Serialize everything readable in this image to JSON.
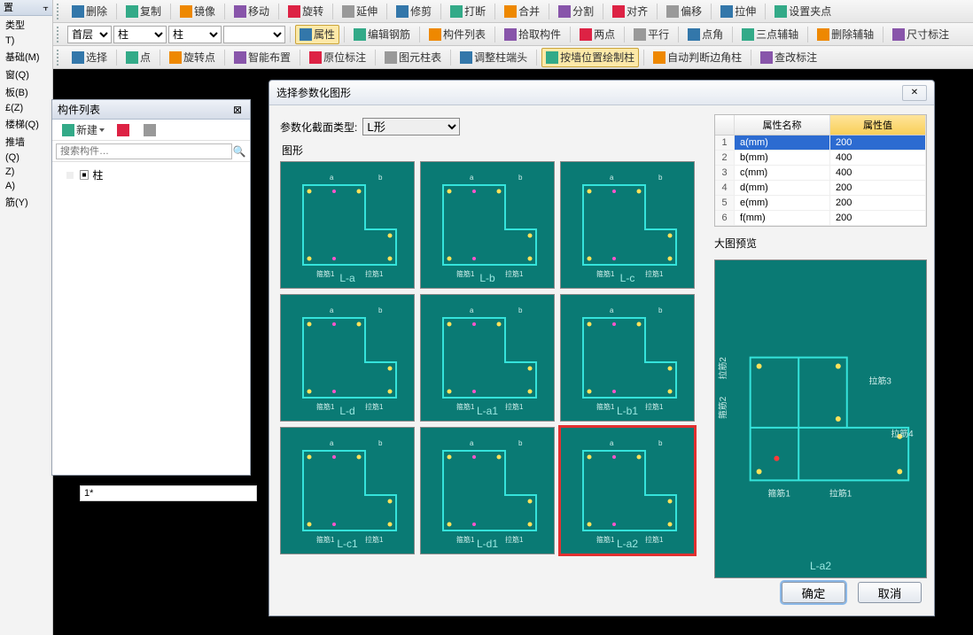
{
  "toolbars": {
    "row1": [
      "删除",
      "复制",
      "镜像",
      "移动",
      "旋转",
      "延伸",
      "修剪",
      "打断",
      "合并",
      "分割",
      "对齐",
      "偏移",
      "拉伸",
      "设置夹点"
    ],
    "row2_floor": "首层",
    "row2_cat1": "柱",
    "row2_cat2": "柱",
    "row2_btns": [
      "属性",
      "编辑钢筋",
      "构件列表",
      "拾取构件",
      "两点",
      "平行",
      "点角",
      "三点辅轴",
      "删除辅轴",
      "尺寸标注"
    ],
    "row3_btns": [
      "选择",
      "点",
      "旋转点",
      "智能布置",
      "原位标注",
      "图元柱表",
      "调整柱端头",
      "按墙位置绘制柱",
      "自动判断边角柱",
      "查改标注"
    ]
  },
  "left_dock": {
    "header": "置",
    "pin": "⫟",
    "nodes": [
      "类型",
      "T)",
      "基础(M)",
      "窗(Q)",
      "板(B)",
      "£(Z)",
      "楼梯(Q)",
      "推墙",
      "(Q)",
      "Z)",
      "A)",
      "筋(Y)"
    ]
  },
  "comp_panel": {
    "title": "构件列表",
    "new_btn": "新建",
    "search_ph": "搜索构件…",
    "tree_item": "柱"
  },
  "bottom_bar": {
    "label": "1*"
  },
  "dialog": {
    "title": "选择参数化图形",
    "close": "✕",
    "param_label": "参数化截面类型:",
    "param_value": "L形",
    "gallery_label": "图形",
    "shapes": [
      "L-a",
      "L-b",
      "L-c",
      "L-d",
      "L-a1",
      "L-b1",
      "L-c1",
      "L-d1",
      "L-a2"
    ],
    "selected_shape": "L-a2",
    "prop_headers": [
      "",
      "属性名称",
      "属性值"
    ],
    "props": [
      {
        "idx": 1,
        "name": "a(mm)",
        "val": "200"
      },
      {
        "idx": 2,
        "name": "b(mm)",
        "val": "400"
      },
      {
        "idx": 3,
        "name": "c(mm)",
        "val": "400"
      },
      {
        "idx": 4,
        "name": "d(mm)",
        "val": "200"
      },
      {
        "idx": 5,
        "name": "e(mm)",
        "val": "200"
      },
      {
        "idx": 6,
        "name": "f(mm)",
        "val": "200"
      }
    ],
    "preview_label": "大图预览",
    "preview_caption": "L-a2",
    "ok": "确定",
    "cancel": "取消"
  }
}
